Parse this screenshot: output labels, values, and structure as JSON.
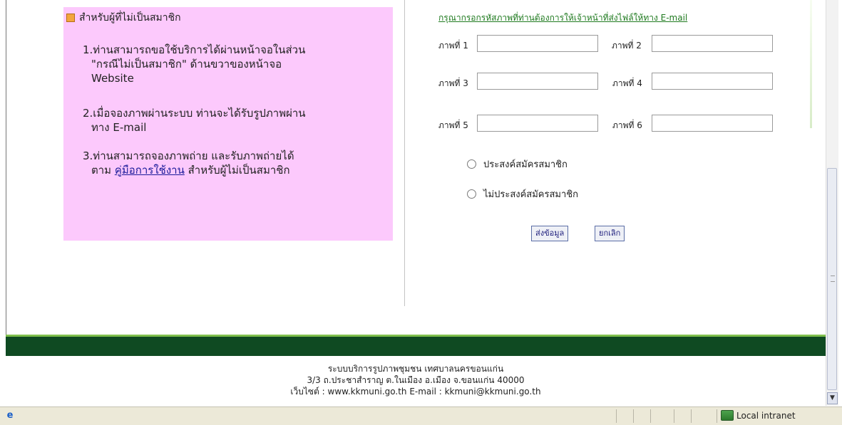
{
  "left_panel": {
    "title": "สำหรับผู้ที่ไม่เป็นสมาชิก",
    "item1_line1": "1.ท่านสามารถขอใช้บริการได้ผ่านหน้าจอในส่วน",
    "item1_line2": "\"กรณีไม่เป็นสมาชิก\" ด้านขวาของหน้าจอ",
    "item1_line3": "Website",
    "item2_line1": "2.เมื่อจองภาพผ่านระบบ ท่านจะได้รับรูปภาพผ่าน",
    "item2_line2": "ทาง E-mail",
    "item3_line1": "3.ท่านสามารถจองภาพถ่าย และรับภาพถ่ายได้",
    "item3_prefix": "ตาม",
    "item3_link": "คู่มือการใช้งาน",
    "item3_suffix": "สำหรับผู้ไม่เป็นสมาชิก"
  },
  "form": {
    "instruction": "กรุณากรอกรหัสภาพที่ท่านต้องการให้เจ้าหน้าที่ส่งไฟล์ให้ทาง E-mail",
    "photo_labels": [
      "ภาพที่ 1",
      "ภาพที่ 2",
      "ภาพที่ 3",
      "ภาพที่ 4",
      "ภาพที่ 5",
      "ภาพที่ 6"
    ],
    "photo_values": [
      "",
      "",
      "",
      "",
      "",
      ""
    ],
    "radio_member": "ประสงค์สมัครสมาชิก",
    "radio_nonmember": "ไม่ประสงค์สมัครสมาชิก",
    "submit_label": "ส่งข้อมูล",
    "cancel_label": "ยกเลิก"
  },
  "footer": {
    "line1": "ระบบบริการรูปภาพชุมชน เทศบาลนครขอนแก่น",
    "line2": "3/3 ถ.ประชาสำราญ ต.ในเมือง อ.เมือง จ.ขอนแก่น 40000",
    "line3": "เว็บไซต์ : www.kkmuni.go.th E-mail : kkmuni@kkmuni.go.th"
  },
  "statusbar": {
    "zone_label": "Local intranet",
    "page_icon": "ie-page-icon",
    "zone_icon": "intranet-zone-icon"
  },
  "colors": {
    "pink_panel": "#fcc9fc",
    "footer_band": "#0f4a22",
    "link_green": "#1f7a1f"
  }
}
